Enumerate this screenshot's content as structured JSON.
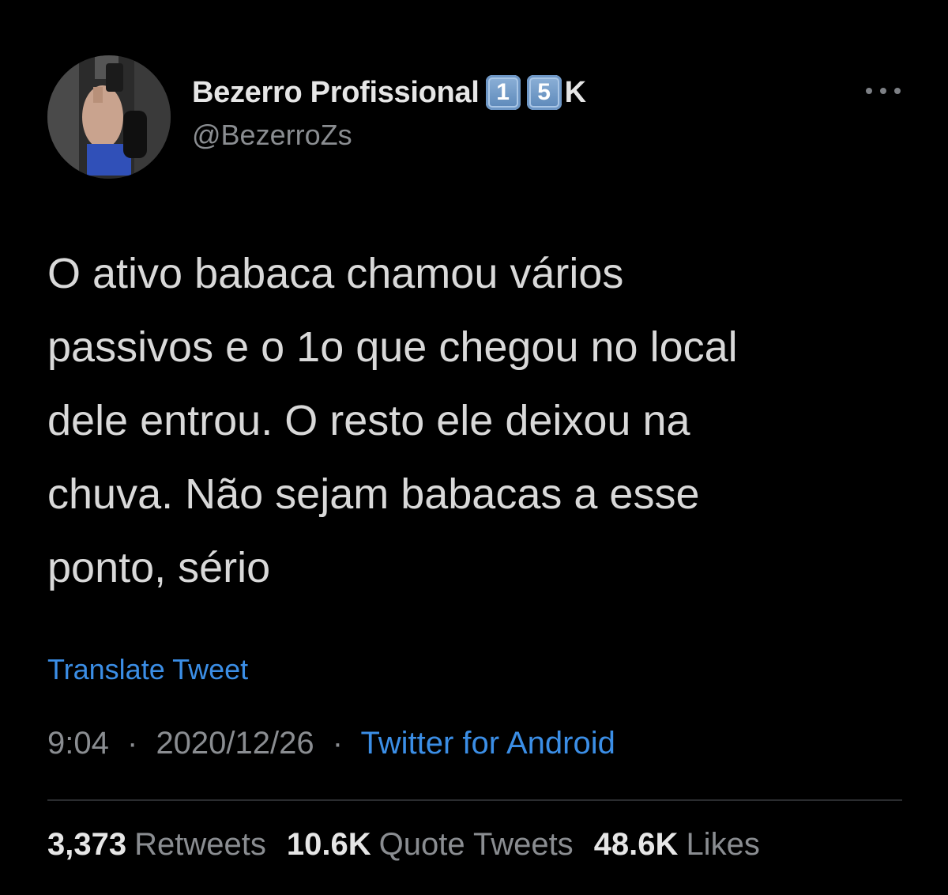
{
  "author": {
    "display_name": "Bezerro Profissional",
    "badge_digits": [
      "1",
      "5"
    ],
    "badge_suffix": "K",
    "handle": "@BezerroZs"
  },
  "icons": {
    "more": "more-horizontal-icon",
    "avatar": "profile-photo"
  },
  "tweet": {
    "text": "O ativo babaca chamou vários\npassivos e o 1o que chegou no local\ndele entrou. O resto ele deixou na\nchuva. Não sejam babacas a esse\nponto, sério",
    "translate_label": "Translate Tweet",
    "time": "9:04",
    "date": "2020/12/26",
    "separator": "·",
    "source": "Twitter for Android"
  },
  "stats": {
    "retweets": {
      "count": "3,373",
      "label": "Retweets"
    },
    "quotes": {
      "count": "10.6K",
      "label": "Quote Tweets"
    },
    "likes": {
      "count": "48.6K",
      "label": "Likes"
    }
  },
  "colors": {
    "background": "#000000",
    "text": "#d9d9d9",
    "secondary": "#8a8d91",
    "link": "#3b8ee6"
  }
}
